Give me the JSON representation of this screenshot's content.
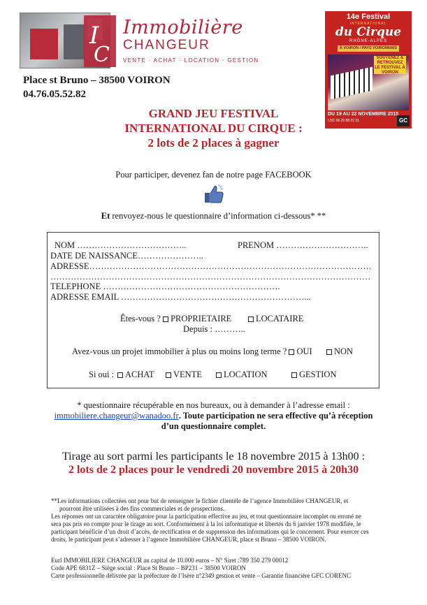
{
  "header": {
    "brand_line1": "Immobilière",
    "brand_line2": "CHANGEUR",
    "brand_tagline": "VENTE · ACHAT · LOCATION · GESTION",
    "address": "Place st Bruno – 38500 VOIRON",
    "phone": "04.76.05.52.82"
  },
  "poster": {
    "edition": "14e Festival",
    "subtitle": "INTERNATIONAL",
    "cirque": "du Cirque",
    "region": "RHÔNE-ALPES",
    "band": "À VOIRON / PAYS VOIRONNAIS",
    "badge": "SOUTENEZ & RETROUVEZ LE FESTIVAL À VOIRON",
    "dates": "DU 19 AU 22 NOVEMBRE 2015",
    "loc": "LOC 06 20 88 22 31",
    "gc": "GC"
  },
  "title": {
    "line1": "GRAND JEU FESTIVAL",
    "line2": "INTERNATIONAL DU CIRQUE :",
    "line3": "2 lots de 2 places à gagner"
  },
  "intro": {
    "participate": "Pour participer, devenez fan de notre page FACEBOOK",
    "send_bold": "Et",
    "send_rest": " renvoyez-nous le questionnaire d’information ci-dessous* **"
  },
  "form": {
    "nom": "NOM ………………………………..",
    "prenom": "PRENOM …………………………..",
    "naissance": "DATE DE NAISSANCE…………………..",
    "adresse": "ADRESSE………………………………………………………………………………………………",
    "adresse2": "……………………………………………………………………………………………………........",
    "telephone": "TELEPHONE …………………………………………………….",
    "email": "ADRESSE EMAIL ………………………………………………………...",
    "etes_vous": "Êtes-vous ?",
    "proprietaire": "PROPRIETAIRE",
    "locataire": "LOCATAIRE",
    "depuis": "Depuis : ………..",
    "projet": "Avez-vous un projet immobilier à plus ou moins long terme ?",
    "oui": "OUI",
    "non": "NON",
    "si_oui": "Si oui :",
    "achat": "ACHAT",
    "vente": "VENTE",
    "location": "LOCATION",
    "gestion": "GESTION"
  },
  "questionnaire": {
    "line1": "* questionnaire récupérable en nos bureaux, ou à demander à l’adresse email :",
    "email": "immobiliere.changeur@wanadoo.fr",
    "bold1": ". Toute participation ne sera effective qu’à réception",
    "bold2": "d’un questionnaire complet."
  },
  "draw": {
    "line1": "Tirage au sort parmi les participants le 18 novembre 2015 à 13h00 :",
    "line2": "2 lots de 2 places pour le vendredi 20 novembre 2015 à 20h30"
  },
  "legal": {
    "p1a": "**Les informations collectées ont pour but de renseigner le fichier clientèle de l’agence Immobilière CHANGEUR,  et",
    "p1b": "pourront être utilisées à des fins commerciales et de prospections.",
    "p2a": "Les réponses ont un caractère obligatoire pour la participation effective au jeu, et tout questionnaire incomplet ou erroné ne",
    "p2b": "sera pas pris en compte pour le tirage au sort. Conformément à la loi informatique et libertés du 6 janvier 1978 modifiée, le",
    "p2c": "participant bénéficie d’un droit d’accès, de rectification et de suppression des informations qui le concernent. Pour exercer ces",
    "p2d": "droits, le participant peut s’adresser à l’agence Immobilière CHANGEUR, place st Bruno – 38500 VOIRON."
  },
  "footer": {
    "l1": "Eurl IMMOBILIERE CHANGEUR au capital de 10.000 euros – N° Siret :789 350 279 00012",
    "l2": "Code APE 6831Z – Siège social : Place St Bruno – BP231 – 38500 VOIRON",
    "l3": "Carte professionnelle délivrée par la préfecture de l’Isère n°2349 gestion et vente – Garantie financière GFC CORENC"
  },
  "colors": {
    "brand_red": "#b5263a",
    "title_red": "#b5262b",
    "link_blue": "#1a3fb0"
  }
}
